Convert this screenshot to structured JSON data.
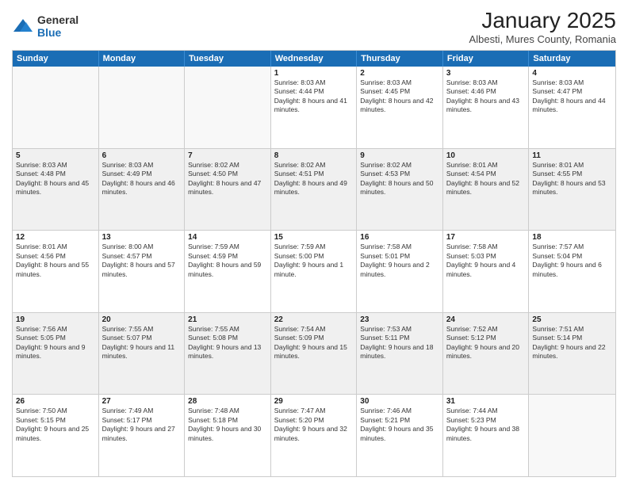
{
  "logo": {
    "general": "General",
    "blue": "Blue"
  },
  "header": {
    "month_year": "January 2025",
    "location": "Albesti, Mures County, Romania"
  },
  "days_of_week": [
    "Sunday",
    "Monday",
    "Tuesday",
    "Wednesday",
    "Thursday",
    "Friday",
    "Saturday"
  ],
  "weeks": [
    [
      {
        "day": "",
        "empty": true
      },
      {
        "day": "",
        "empty": true
      },
      {
        "day": "",
        "empty": true
      },
      {
        "day": "1",
        "sunrise": "8:03 AM",
        "sunset": "4:44 PM",
        "daylight": "8 hours and 41 minutes."
      },
      {
        "day": "2",
        "sunrise": "8:03 AM",
        "sunset": "4:45 PM",
        "daylight": "8 hours and 42 minutes."
      },
      {
        "day": "3",
        "sunrise": "8:03 AM",
        "sunset": "4:46 PM",
        "daylight": "8 hours and 43 minutes."
      },
      {
        "day": "4",
        "sunrise": "8:03 AM",
        "sunset": "4:47 PM",
        "daylight": "8 hours and 44 minutes."
      }
    ],
    [
      {
        "day": "5",
        "sunrise": "8:03 AM",
        "sunset": "4:48 PM",
        "daylight": "8 hours and 45 minutes."
      },
      {
        "day": "6",
        "sunrise": "8:03 AM",
        "sunset": "4:49 PM",
        "daylight": "8 hours and 46 minutes."
      },
      {
        "day": "7",
        "sunrise": "8:02 AM",
        "sunset": "4:50 PM",
        "daylight": "8 hours and 47 minutes."
      },
      {
        "day": "8",
        "sunrise": "8:02 AM",
        "sunset": "4:51 PM",
        "daylight": "8 hours and 49 minutes."
      },
      {
        "day": "9",
        "sunrise": "8:02 AM",
        "sunset": "4:53 PM",
        "daylight": "8 hours and 50 minutes."
      },
      {
        "day": "10",
        "sunrise": "8:01 AM",
        "sunset": "4:54 PM",
        "daylight": "8 hours and 52 minutes."
      },
      {
        "day": "11",
        "sunrise": "8:01 AM",
        "sunset": "4:55 PM",
        "daylight": "8 hours and 53 minutes."
      }
    ],
    [
      {
        "day": "12",
        "sunrise": "8:01 AM",
        "sunset": "4:56 PM",
        "daylight": "8 hours and 55 minutes."
      },
      {
        "day": "13",
        "sunrise": "8:00 AM",
        "sunset": "4:57 PM",
        "daylight": "8 hours and 57 minutes."
      },
      {
        "day": "14",
        "sunrise": "7:59 AM",
        "sunset": "4:59 PM",
        "daylight": "8 hours and 59 minutes."
      },
      {
        "day": "15",
        "sunrise": "7:59 AM",
        "sunset": "5:00 PM",
        "daylight": "9 hours and 1 minute."
      },
      {
        "day": "16",
        "sunrise": "7:58 AM",
        "sunset": "5:01 PM",
        "daylight": "9 hours and 2 minutes."
      },
      {
        "day": "17",
        "sunrise": "7:58 AM",
        "sunset": "5:03 PM",
        "daylight": "9 hours and 4 minutes."
      },
      {
        "day": "18",
        "sunrise": "7:57 AM",
        "sunset": "5:04 PM",
        "daylight": "9 hours and 6 minutes."
      }
    ],
    [
      {
        "day": "19",
        "sunrise": "7:56 AM",
        "sunset": "5:05 PM",
        "daylight": "9 hours and 9 minutes."
      },
      {
        "day": "20",
        "sunrise": "7:55 AM",
        "sunset": "5:07 PM",
        "daylight": "9 hours and 11 minutes."
      },
      {
        "day": "21",
        "sunrise": "7:55 AM",
        "sunset": "5:08 PM",
        "daylight": "9 hours and 13 minutes."
      },
      {
        "day": "22",
        "sunrise": "7:54 AM",
        "sunset": "5:09 PM",
        "daylight": "9 hours and 15 minutes."
      },
      {
        "day": "23",
        "sunrise": "7:53 AM",
        "sunset": "5:11 PM",
        "daylight": "9 hours and 18 minutes."
      },
      {
        "day": "24",
        "sunrise": "7:52 AM",
        "sunset": "5:12 PM",
        "daylight": "9 hours and 20 minutes."
      },
      {
        "day": "25",
        "sunrise": "7:51 AM",
        "sunset": "5:14 PM",
        "daylight": "9 hours and 22 minutes."
      }
    ],
    [
      {
        "day": "26",
        "sunrise": "7:50 AM",
        "sunset": "5:15 PM",
        "daylight": "9 hours and 25 minutes."
      },
      {
        "day": "27",
        "sunrise": "7:49 AM",
        "sunset": "5:17 PM",
        "daylight": "9 hours and 27 minutes."
      },
      {
        "day": "28",
        "sunrise": "7:48 AM",
        "sunset": "5:18 PM",
        "daylight": "9 hours and 30 minutes."
      },
      {
        "day": "29",
        "sunrise": "7:47 AM",
        "sunset": "5:20 PM",
        "daylight": "9 hours and 32 minutes."
      },
      {
        "day": "30",
        "sunrise": "7:46 AM",
        "sunset": "5:21 PM",
        "daylight": "9 hours and 35 minutes."
      },
      {
        "day": "31",
        "sunrise": "7:44 AM",
        "sunset": "5:23 PM",
        "daylight": "9 hours and 38 minutes."
      },
      {
        "day": "",
        "empty": true
      }
    ]
  ]
}
